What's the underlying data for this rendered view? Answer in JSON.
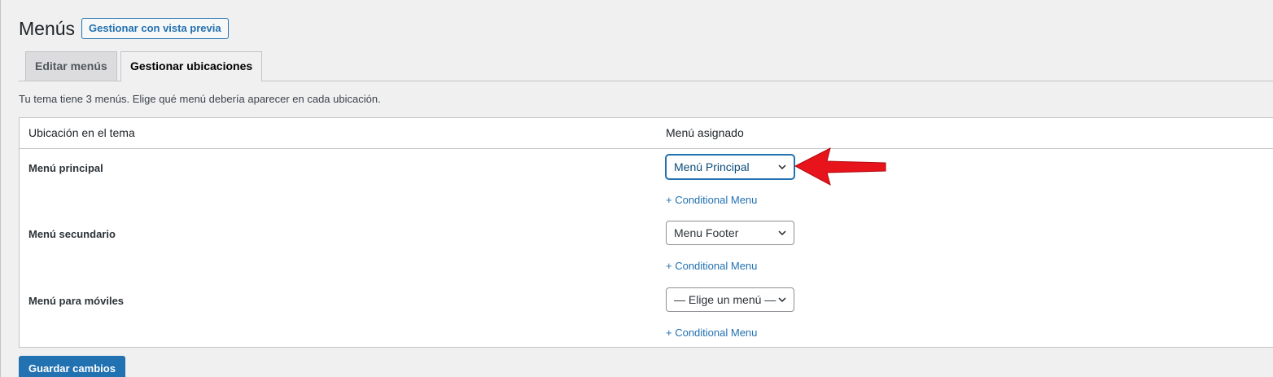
{
  "header": {
    "title": "Menús",
    "preview_label": "Gestionar con vista previa"
  },
  "tabs": [
    {
      "label": "Editar menús",
      "active": false
    },
    {
      "label": "Gestionar ubicaciones",
      "active": true
    }
  ],
  "description": "Tu tema tiene 3 menús. Elige qué menú debería aparecer en cada ubicación.",
  "table": {
    "col_location": "Ubicación en el tema",
    "col_menu": "Menú asignado",
    "rows": [
      {
        "location": "Menú principal",
        "menu": "Menú Principal",
        "link": "+ Conditional Menu"
      },
      {
        "location": "Menú secundario",
        "menu": "Menu Footer",
        "link": "+ Conditional Menu"
      },
      {
        "location": "Menú para móviles",
        "menu": "— Elige un menú —",
        "link": "+ Conditional Menu"
      }
    ]
  },
  "save_label": "Guardar cambios",
  "colors": {
    "accent": "#2271b1",
    "annotation_arrow": "#e8141b"
  },
  "icons": {
    "select_indicator": "chevron-down-icon",
    "annotation": "red-arrow-icon"
  }
}
